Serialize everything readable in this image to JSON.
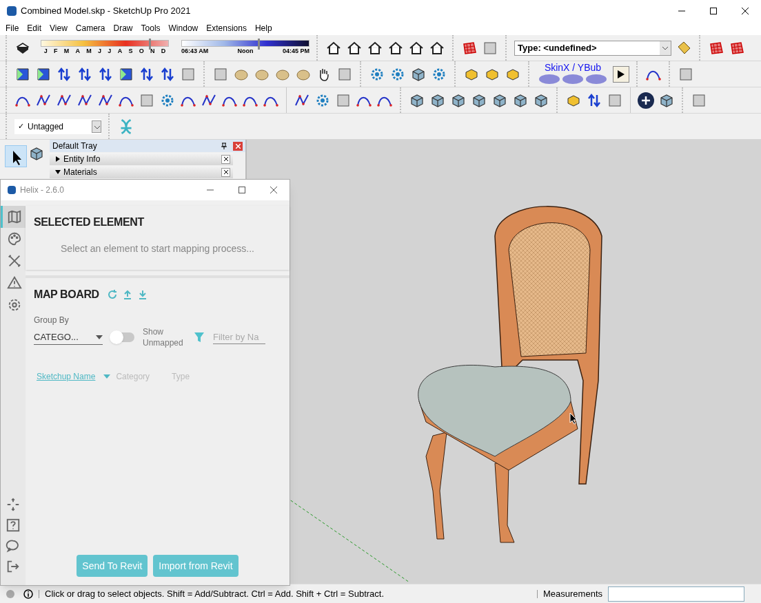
{
  "window": {
    "title": "Combined Model.skp - SketchUp Pro 2021"
  },
  "menu": [
    "File",
    "Edit",
    "View",
    "Camera",
    "Draw",
    "Tools",
    "Window",
    "Extensions",
    "Help"
  ],
  "shadows": {
    "months": [
      "J",
      "F",
      "M",
      "A",
      "M",
      "J",
      "J",
      "A",
      "S",
      "O",
      "N",
      "D"
    ],
    "date_slider": {
      "level": 0.85
    },
    "time_labels": [
      "06:43 AM",
      "Noon",
      "04:45 PM"
    ],
    "time_slider": {
      "level": 0.6
    }
  },
  "type_dropdown": {
    "value": "Type: <undefined>"
  },
  "skinx": {
    "label": "SkinX / YBub"
  },
  "tag_dropdown": {
    "check": "✓",
    "value": "Untagged"
  },
  "tray": {
    "title": "Default Tray",
    "panels": [
      {
        "label": "Entity Info",
        "expanded": false
      },
      {
        "label": "Materials",
        "expanded": true
      }
    ]
  },
  "helix": {
    "title": "Helix - 2.6.0",
    "nav": [
      {
        "kind": "map",
        "selected": true
      },
      {
        "kind": "palette",
        "selected": false
      },
      {
        "kind": "tools",
        "selected": false
      },
      {
        "kind": "warning",
        "selected": false
      },
      {
        "kind": "settings",
        "selected": false
      }
    ],
    "bottom_nav": [
      {
        "kind": "move"
      },
      {
        "kind": "help"
      },
      {
        "kind": "chat"
      },
      {
        "kind": "logout"
      }
    ],
    "selected_element": {
      "heading": "SELECTED ELEMENT",
      "message": "Select an element to start mapping process..."
    },
    "map_board": {
      "heading": "MAP BOARD",
      "group_by_label": "Group By",
      "group_by_value": "CATEGO...",
      "toggle": {
        "label": "Show Unmapped",
        "on": false
      },
      "filter": {
        "placeholder": "Filter by Na"
      },
      "columns": [
        {
          "label": "Sketchup Name",
          "selected": true
        },
        {
          "label": "Category",
          "selected": false
        },
        {
          "label": "Type",
          "selected": false
        }
      ]
    },
    "buttons": [
      "Send To Revit",
      "Import from Revit"
    ]
  },
  "status_bar": {
    "message": "Click or drag to select objects. Shift = Add/Subtract. Ctrl = Add. Shift + Ctrl = Subtract.",
    "measurements_label": "Measurements"
  }
}
